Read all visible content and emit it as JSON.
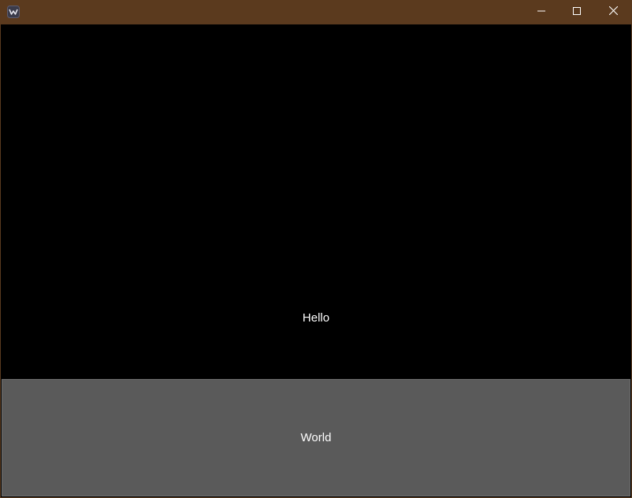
{
  "window": {
    "icon": "kivy-app-icon",
    "controls": {
      "minimize": "minimize-icon",
      "maximize": "maximize-icon",
      "close": "close-icon"
    },
    "titlebar_color": "#5b3a1e"
  },
  "content": {
    "label_text": "Hello",
    "button_text": "World",
    "background_color": "#000000",
    "button_color": "#5a5a5a"
  }
}
